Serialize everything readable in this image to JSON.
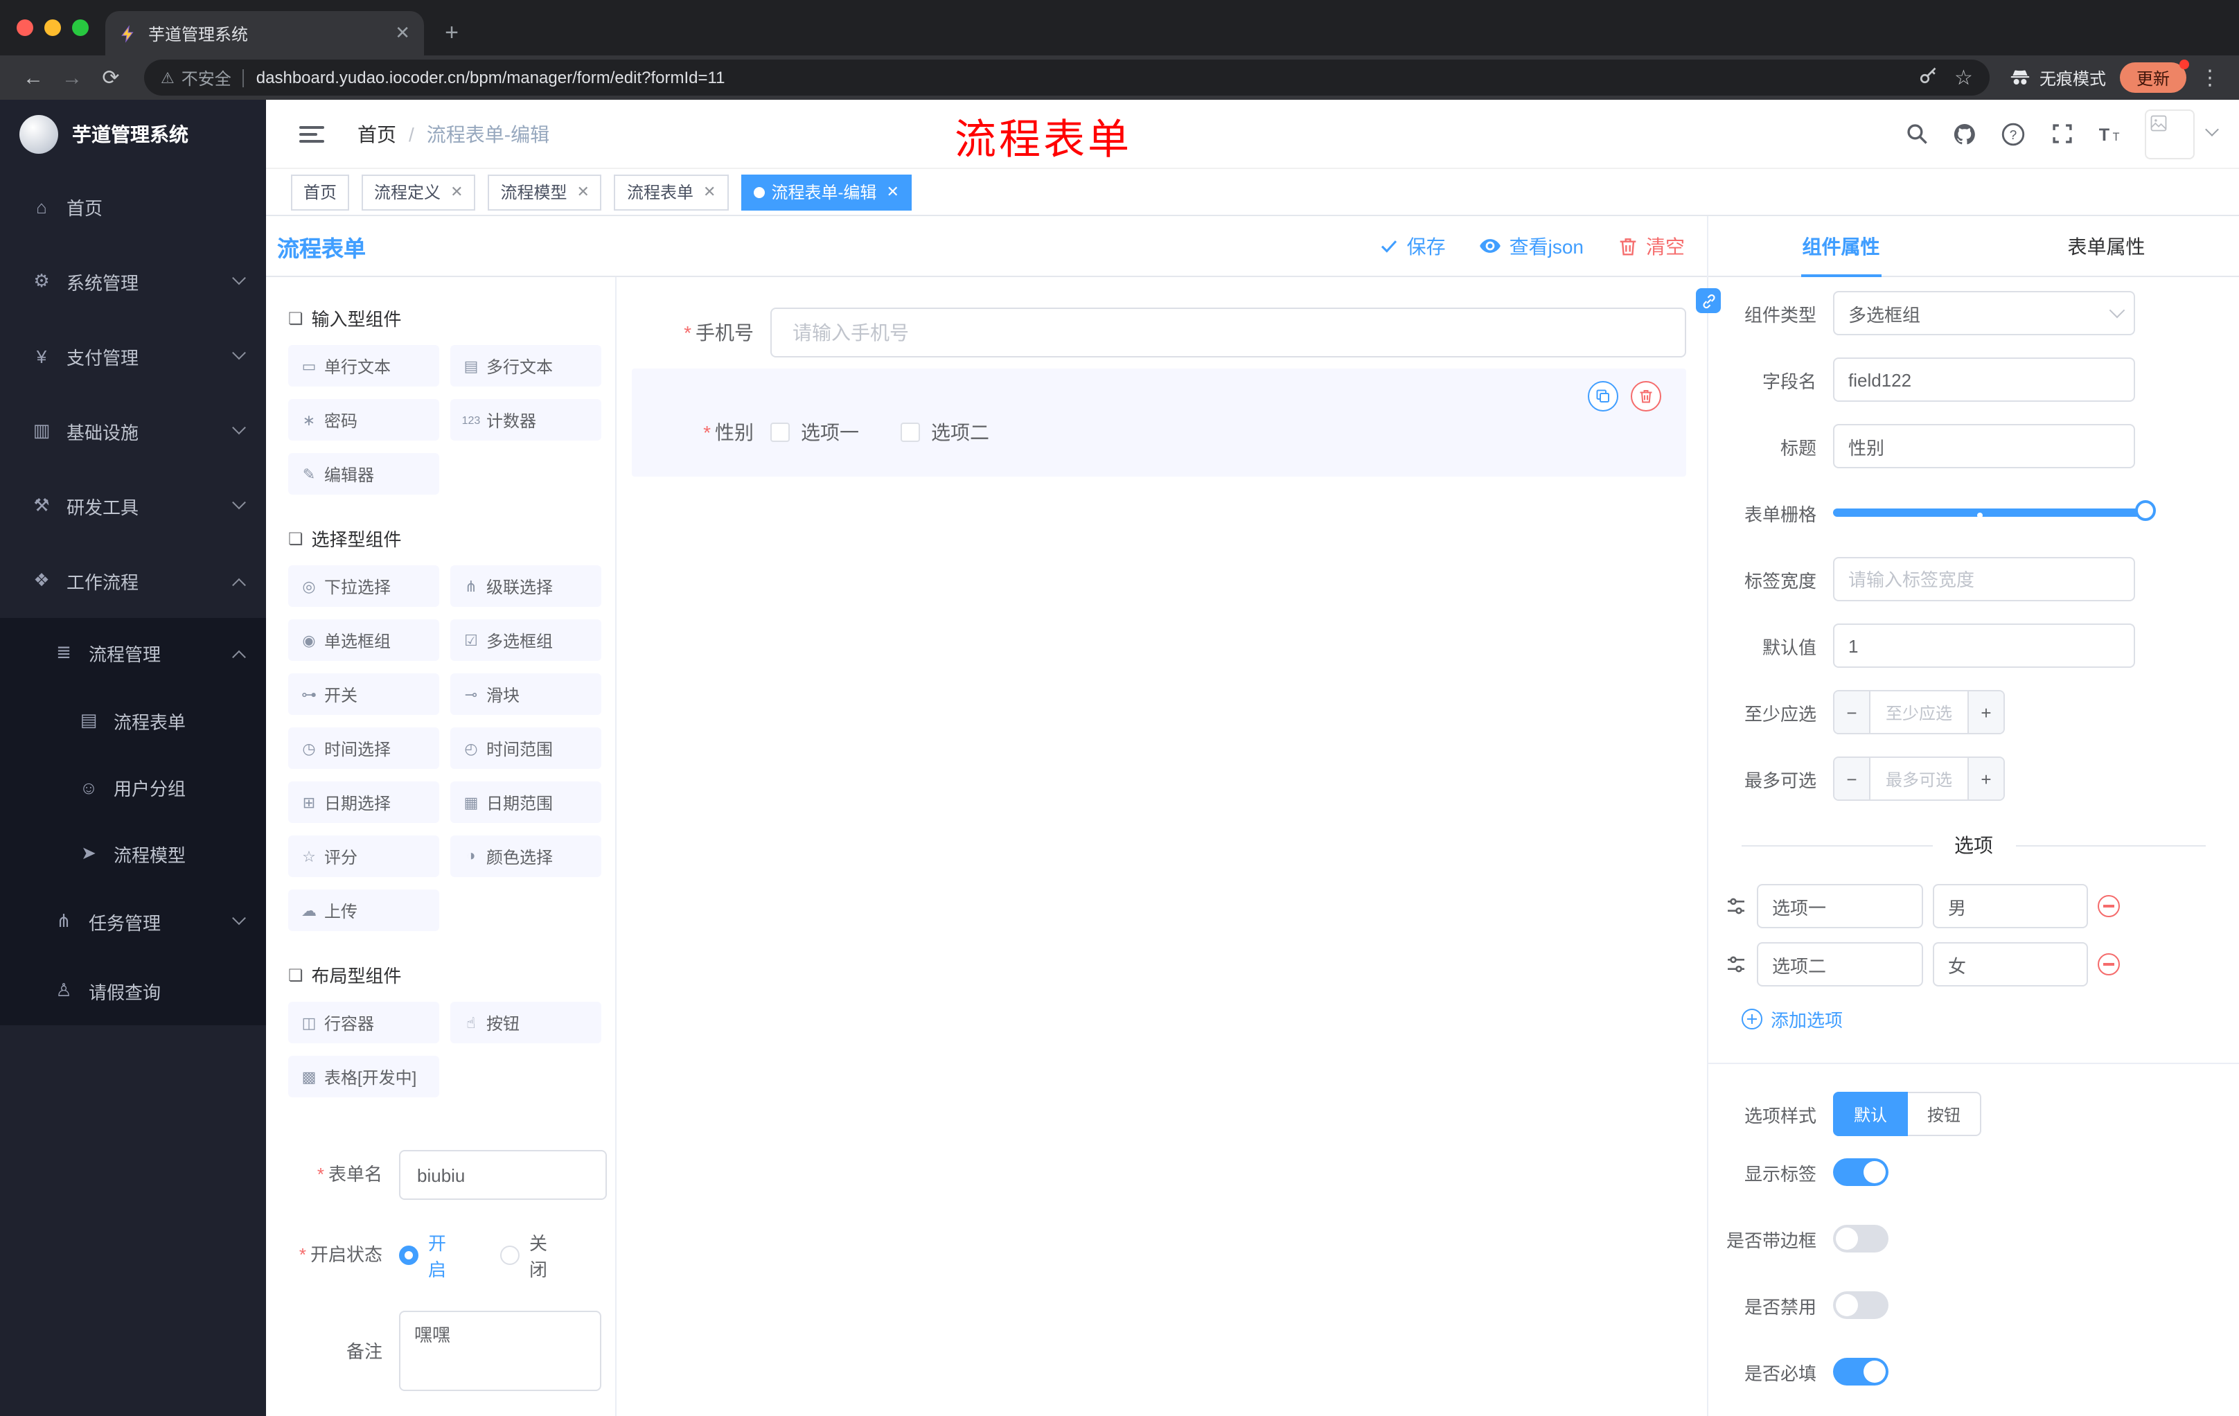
{
  "colors": {
    "accent": "#409eff",
    "danger": "#f56c6c",
    "annotation": "#ff0000"
  },
  "browser": {
    "tab_title": "芋道管理系统",
    "security_label": "不安全",
    "url": "dashboard.yudao.iocoder.cn/bpm/manager/form/edit?formId=11",
    "incognito_label": "无痕模式",
    "update_label": "更新"
  },
  "annotation": "流程表单",
  "sidebar": {
    "logo_title": "芋道管理系统",
    "items": [
      {
        "glyph": "⌂",
        "label": "首页"
      },
      {
        "glyph": "⚙",
        "label": "系统管理"
      },
      {
        "glyph": "¥",
        "label": "支付管理"
      },
      {
        "glyph": "▥",
        "label": "基础设施"
      },
      {
        "glyph": "⚒",
        "label": "研发工具"
      },
      {
        "glyph": "❖",
        "label": "工作流程"
      }
    ],
    "submenu": {
      "glyph": "≣",
      "label": "流程管理",
      "children": [
        {
          "glyph": "▤",
          "label": "流程表单"
        },
        {
          "glyph": "☺",
          "label": "用户分组"
        },
        {
          "glyph": "➤",
          "label": "流程模型"
        }
      ]
    },
    "more": [
      {
        "glyph": "⋔",
        "label": "任务管理"
      },
      {
        "glyph": "♙",
        "label": "请假查询"
      }
    ]
  },
  "breadcrumb": {
    "home": "首页",
    "current": "流程表单-编辑"
  },
  "tags": [
    {
      "label": "首页"
    },
    {
      "label": "流程定义"
    },
    {
      "label": "流程模型"
    },
    {
      "label": "流程表单"
    },
    {
      "label": "流程表单-编辑"
    }
  ],
  "builder": {
    "title": "流程表单",
    "save": "保存",
    "view_json": "查看json",
    "clear": "清空",
    "groups": [
      {
        "title": "输入型组件",
        "items": [
          {
            "glyph": "▭",
            "label": "单行文本"
          },
          {
            "glyph": "▤",
            "label": "多行文本"
          },
          {
            "glyph": "∗",
            "label": "密码"
          },
          {
            "glyph": "123",
            "label": "计数器"
          },
          {
            "glyph": "✎",
            "label": "编辑器"
          }
        ]
      },
      {
        "title": "选择型组件",
        "items": [
          {
            "glyph": "◎",
            "label": "下拉选择"
          },
          {
            "glyph": "⋔",
            "label": "级联选择"
          },
          {
            "glyph": "◉",
            "label": "单选框组"
          },
          {
            "glyph": "☑",
            "label": "多选框组"
          },
          {
            "glyph": "⊶",
            "label": "开关"
          },
          {
            "glyph": "⊸",
            "label": "滑块"
          },
          {
            "glyph": "◷",
            "label": "时间选择"
          },
          {
            "glyph": "◴",
            "label": "时间范围"
          },
          {
            "glyph": "⊞",
            "label": "日期选择"
          },
          {
            "glyph": "▦",
            "label": "日期范围"
          },
          {
            "glyph": "☆",
            "label": "评分"
          },
          {
            "glyph": "◑",
            "label": "颜色选择"
          },
          {
            "glyph": "☁",
            "label": "上传"
          }
        ]
      },
      {
        "title": "布局型组件",
        "items": [
          {
            "glyph": "◫",
            "label": "行容器"
          },
          {
            "glyph": "☝",
            "label": "按钮"
          },
          {
            "glyph": "▩",
            "label": "表格[开发中]"
          }
        ]
      }
    ],
    "meta": {
      "form_name_label": "表单名",
      "form_name_value": "biubiu",
      "status_label": "开启状态",
      "status_on": "开启",
      "status_off": "关闭",
      "remark_label": "备注",
      "remark_value": "嘿嘿"
    },
    "canvas": {
      "phone_label": "手机号",
      "phone_placeholder": "请输入手机号",
      "gender_label": "性别",
      "gender_opt1": "选项一",
      "gender_opt2": "选项二"
    }
  },
  "props": {
    "tab_component": "组件属性",
    "tab_form": "表单属性",
    "component_type_label": "组件类型",
    "component_type_value": "多选框组",
    "field_name_label": "字段名",
    "field_name_value": "field122",
    "title_label": "标题",
    "title_value": "性别",
    "grid_label": "表单栅格",
    "label_width_label": "标签宽度",
    "label_width_placeholder": "请输入标签宽度",
    "default_label": "默认值",
    "default_value": "1",
    "min_label": "至少应选",
    "min_placeholder": "至少应选",
    "max_label": "最多可选",
    "max_placeholder": "最多可选",
    "options_title": "选项",
    "options": [
      {
        "label": "选项一",
        "value": "男"
      },
      {
        "label": "选项二",
        "value": "女"
      }
    ],
    "add_option": "添加选项",
    "style_label": "选项样式",
    "style_default": "默认",
    "style_button": "按钮",
    "switch_show_label": "显示标签",
    "switch_border": "是否带边框",
    "switch_disabled": "是否禁用",
    "switch_required": "是否必填"
  }
}
